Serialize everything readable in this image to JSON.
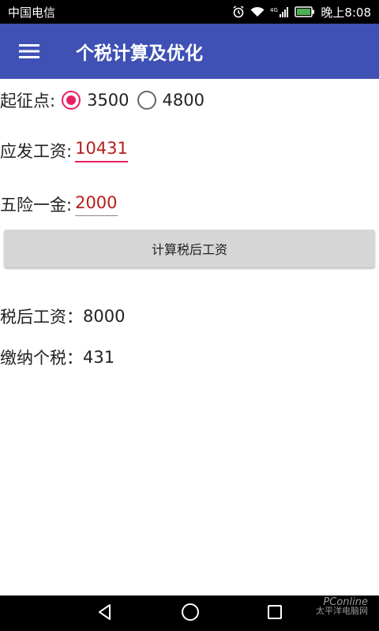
{
  "status_bar": {
    "carrier": "中国电信",
    "time": "晚上8:08",
    "icons": [
      "alarm-icon",
      "wifi-icon",
      "signal-4g-icon",
      "battery-icon"
    ]
  },
  "app_bar": {
    "title": "个税计算及优化",
    "menu_icon": "menu-icon"
  },
  "threshold": {
    "label": "起征点:",
    "options": [
      {
        "label": "3500",
        "selected": true
      },
      {
        "label": "4800",
        "selected": false
      }
    ]
  },
  "gross_salary": {
    "label": "应发工资:",
    "value": "10431"
  },
  "insurance_fund": {
    "label": "五险一金:",
    "value": "2000"
  },
  "calculate_button": {
    "label": "计算税后工资"
  },
  "results": {
    "after_tax_label": "税后工资：",
    "after_tax_value": "8000",
    "tax_label": "缴纳个税：",
    "tax_value": "431"
  },
  "watermark": {
    "brand": "PConline",
    "sub": "太平洋电脑网"
  },
  "nav_bar": {
    "icons": [
      "back-icon",
      "home-icon",
      "recents-icon"
    ]
  },
  "colors": {
    "app_bar": "#3f51b5",
    "accent": "#e91e63",
    "value_text": "#b71c1c"
  }
}
